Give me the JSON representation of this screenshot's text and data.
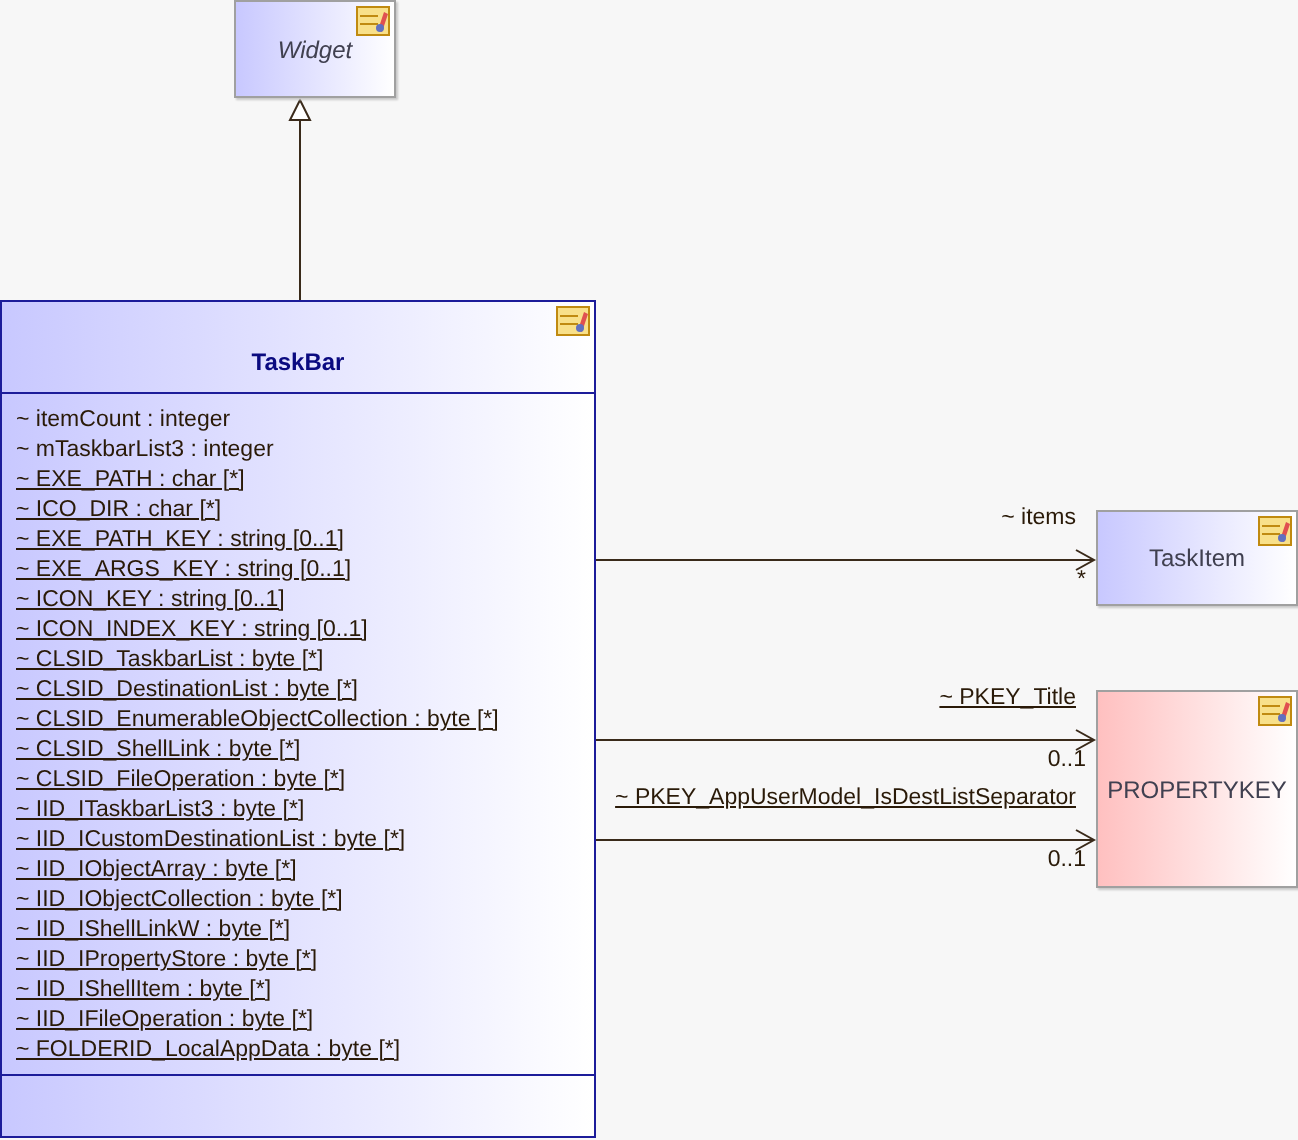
{
  "classes": [
    {
      "name": "Widget",
      "abstract": true,
      "color": "#c8c8ff"
    },
    {
      "name": "TaskBar",
      "abstract": false,
      "color": "#c8c8ff",
      "attributes": [
        {
          "text": "~ itemCount : integer",
          "static": false
        },
        {
          "text": "~ mTaskbarList3 : integer",
          "static": false
        },
        {
          "text": "~ EXE_PATH : char [*]",
          "static": true
        },
        {
          "text": "~ ICO_DIR : char [*]",
          "static": true
        },
        {
          "text": "~ EXE_PATH_KEY : string [0..1]",
          "static": true
        },
        {
          "text": "~ EXE_ARGS_KEY : string [0..1]",
          "static": true
        },
        {
          "text": "~ ICON_KEY : string [0..1]",
          "static": true
        },
        {
          "text": "~ ICON_INDEX_KEY : string [0..1]",
          "static": true
        },
        {
          "text": "~ CLSID_TaskbarList : byte [*]",
          "static": true
        },
        {
          "text": "~ CLSID_DestinationList : byte [*]",
          "static": true
        },
        {
          "text": "~ CLSID_EnumerableObjectCollection : byte [*]",
          "static": true
        },
        {
          "text": "~ CLSID_ShellLink : byte [*]",
          "static": true
        },
        {
          "text": "~ CLSID_FileOperation : byte [*]",
          "static": true
        },
        {
          "text": "~ IID_ITaskbarList3 : byte [*]",
          "static": true
        },
        {
          "text": "~ IID_ICustomDestinationList : byte [*]",
          "static": true
        },
        {
          "text": "~ IID_IObjectArray : byte [*]",
          "static": true
        },
        {
          "text": "~ IID_IObjectCollection : byte [*]",
          "static": true
        },
        {
          "text": "~ IID_IShellLinkW : byte [*]",
          "static": true
        },
        {
          "text": "~ IID_IPropertyStore : byte [*]",
          "static": true
        },
        {
          "text": "~ IID_IShellItem : byte [*]",
          "static": true
        },
        {
          "text": "~ IID_IFileOperation : byte [*]",
          "static": true
        },
        {
          "text": "~ FOLDERID_LocalAppData : byte [*]",
          "static": true
        }
      ]
    },
    {
      "name": "TaskItem",
      "abstract": false,
      "color": "#c8c8ff"
    },
    {
      "name": "PROPERTYKEY",
      "abstract": false,
      "color": "#ffc0c0"
    }
  ],
  "connectors": [
    {
      "kind": "generalization"
    },
    {
      "kind": "association",
      "role": "~ items",
      "static": false,
      "multiplicity": "*"
    },
    {
      "kind": "association",
      "role": "~ PKEY_Title",
      "static": true,
      "multiplicity": "0..1"
    },
    {
      "kind": "association",
      "role": "~ PKEY_AppUserModel_IsDestListSeparator",
      "static": true,
      "multiplicity": "0..1"
    }
  ]
}
